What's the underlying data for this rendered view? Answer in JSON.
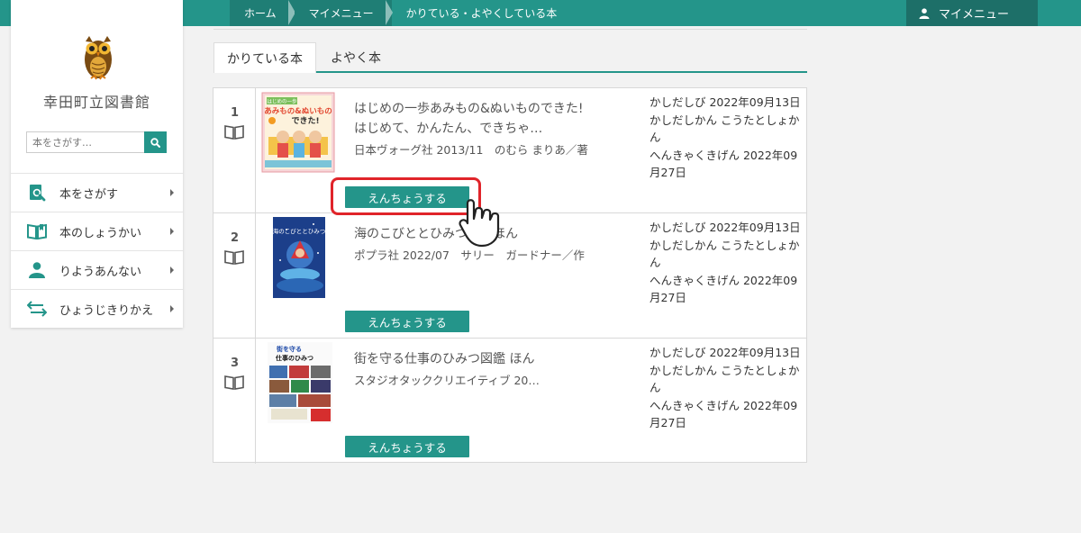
{
  "header": {
    "breadcrumbs": [
      "ホーム",
      "マイメニュー",
      "かりている・よやくしている本"
    ],
    "mymenu_label": "マイメニュー"
  },
  "sidebar": {
    "library_name": "幸田町立図書館",
    "search_placeholder": "本をさがす…",
    "items": [
      {
        "label": "本をさがす",
        "icon": "search-book-icon"
      },
      {
        "label": "本のしょうかい",
        "icon": "open-book-icon"
      },
      {
        "label": "りようあんない",
        "icon": "user-icon"
      },
      {
        "label": "ひょうじきりかえ",
        "icon": "switch-arrows-icon"
      }
    ]
  },
  "tabs": {
    "borrowed": "かりている本",
    "reserved": "よやく本"
  },
  "books": [
    {
      "num": "1",
      "title": "はじめの一歩あみもの&ぬいものできた!",
      "subtitle": "はじめて、かんたん、できちゃ…",
      "publisher": "日本ヴォーグ社 2013/11　のむら まりあ／著",
      "cover_text_1": "はじめの一歩",
      "cover_text_2": "あみもの&ぬいもの",
      "cover_text_3": "できた!",
      "borrow_date": "かしだしび 2022年09月13日",
      "branch": "かしだしかん こうたとしょかん",
      "due_date": "へんきゃくきげん 2022年09月27日",
      "button": "えんちょうする"
    },
    {
      "num": "2",
      "title": "海のこびととひみつの…ほん",
      "subtitle": "",
      "publisher": "ポプラ社 2022/07　サリー　ガードナー／作",
      "cover_text_1": "海のこびととひみつ",
      "cover_text_2": "",
      "cover_text_3": "",
      "borrow_date": "かしだしび 2022年09月13日",
      "branch": "かしだしかん こうたとしょかん",
      "due_date": "へんきゃくきげん 2022年09月27日",
      "button": "えんちょうする"
    },
    {
      "num": "3",
      "title": "街を守る仕事のひみつ図鑑 ほん",
      "subtitle": "",
      "publisher": "スタジオタッククリエイティブ 20…",
      "cover_text_1": "街を守る",
      "cover_text_2": "仕事のひみつ",
      "cover_text_3": "",
      "borrow_date": "かしだしび 2022年09月13日",
      "branch": "かしだしかん こうたとしょかん",
      "due_date": "へんきゃくきげん 2022年09月27日",
      "button": "えんちょうする"
    }
  ],
  "colors": {
    "accent": "#24958a",
    "header_dark": "#1d6f68",
    "highlight": "#e0242a"
  }
}
